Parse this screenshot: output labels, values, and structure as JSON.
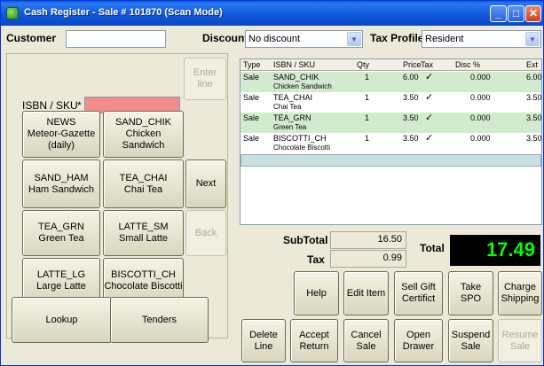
{
  "window": {
    "title": "Cash Register - Sale # 101870  (Scan Mode)"
  },
  "header": {
    "customer_label": "Customer",
    "customer_value": "",
    "discount_label": "Discount",
    "discount_value": "No discount",
    "tax_profile_label": "Tax Profile",
    "tax_profile_value": "Resident"
  },
  "entry": {
    "isbn_label": "ISBN / SKU",
    "required_mark": "*",
    "isbn_value": "",
    "enter_line_label": "Enter line"
  },
  "quick_buttons": [
    {
      "code": "NEWS",
      "name": "Meteor-Gazette",
      "extra": "(daily)"
    },
    {
      "code": "SAND_CHIK",
      "name": "Chicken Sandwich",
      "extra": ""
    },
    {
      "code": "SAND_HAM",
      "name": "Ham Sandwich",
      "extra": ""
    },
    {
      "code": "TEA_CHAI",
      "name": "Chai Tea",
      "extra": ""
    },
    {
      "code": "TEA_GRN",
      "name": "Green Tea",
      "extra": ""
    },
    {
      "code": "LATTE_SM",
      "name": "Small Latte",
      "extra": ""
    },
    {
      "code": "LATTE_LG",
      "name": "Large Latte",
      "extra": ""
    },
    {
      "code": "BISCOTTI_CH",
      "name": "Chocolate Biscotti",
      "extra": ""
    }
  ],
  "paging": {
    "next_label": "Next",
    "back_label": "Back"
  },
  "left_bottom": {
    "lookup_label": "Lookup",
    "tenders_label": "Tenders"
  },
  "grid": {
    "columns": [
      "Type",
      "ISBN / SKU",
      "Qty",
      "Price",
      "Tax",
      "Disc %",
      "Ext"
    ],
    "rows": [
      {
        "type": "Sale",
        "sku": "SAND_CHIK",
        "desc": "Chicken Sandwich",
        "qty": "1",
        "price": "6.00",
        "tax": "✓",
        "disc": "0.000",
        "ext": "6.00"
      },
      {
        "type": "Sale",
        "sku": "TEA_CHAI",
        "desc": "Chai Tea",
        "qty": "1",
        "price": "3.50",
        "tax": "✓",
        "disc": "0.000",
        "ext": "3.50"
      },
      {
        "type": "Sale",
        "sku": "TEA_GRN",
        "desc": "Green Tea",
        "qty": "1",
        "price": "3.50",
        "tax": "✓",
        "disc": "0.000",
        "ext": "3.50"
      },
      {
        "type": "Sale",
        "sku": "BISCOTTI_CH",
        "desc": "Chocolate Biscotti",
        "qty": "1",
        "price": "3.50",
        "tax": "✓",
        "disc": "0.000",
        "ext": "3.50"
      }
    ]
  },
  "totals": {
    "subtotal_label": "SubTotal",
    "subtotal_value": "16.50",
    "tax_label": "Tax",
    "tax_value": "0.99",
    "total_label": "Total",
    "total_value": "17.49"
  },
  "actions": {
    "help": "Help",
    "edit_item": "Edit Item",
    "sell_gift_1": "Sell Gift",
    "sell_gift_2": "Certifict",
    "take_spo": "Take SPO",
    "charge_1": "Charge",
    "charge_2": "Shipping",
    "delete_1": "Delete",
    "delete_2": "Line",
    "accept_1": "Accept",
    "accept_2": "Return",
    "cancel_1": "Cancel",
    "cancel_2": "Sale",
    "open_1": "Open",
    "open_2": "Drawer",
    "suspend_1": "Suspend",
    "suspend_2": "Sale",
    "resume_1": "Resume",
    "resume_2": "Sale"
  },
  "colors": {
    "total_fg": "#00ff00",
    "isbn_bg": "#f58c8c",
    "row_alt": "#d2ebcf"
  }
}
